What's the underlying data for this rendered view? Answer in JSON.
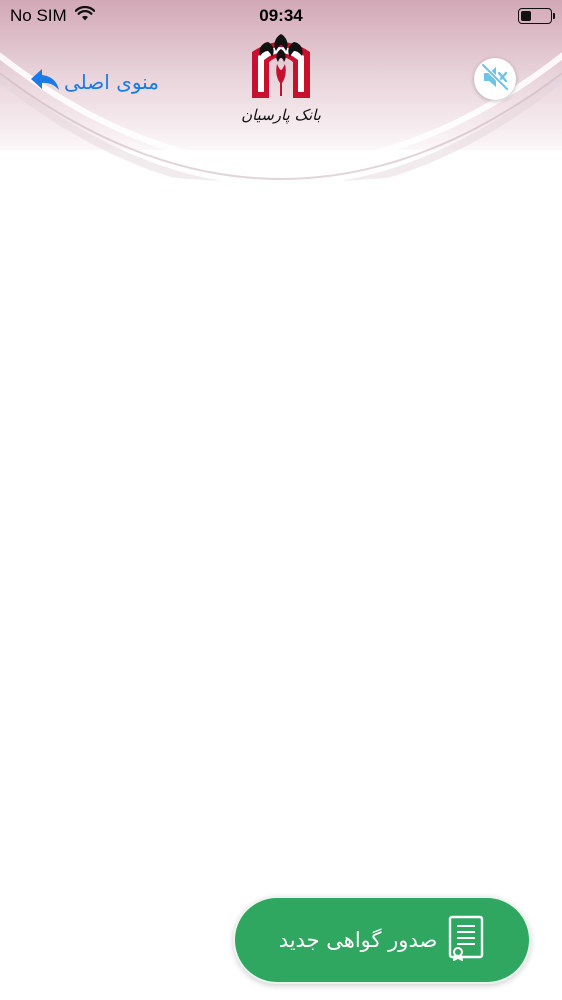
{
  "status_bar": {
    "carrier": "No SIM",
    "time": "09:34",
    "battery_level": 0.35
  },
  "header": {
    "back_label": "منوی اصلی",
    "back_icon": "reply-arrow-icon",
    "logo_text": "بانک پارسیان",
    "mute_icon": "speaker-muted-icon"
  },
  "actions": {
    "issue_certificate_label": "صدور گواهی جدید",
    "issue_certificate_icon": "certificate-document-icon"
  },
  "colors": {
    "accent_blue": "#1a7be8",
    "brand_red": "#c8102e",
    "primary_green": "#2fa761",
    "header_pink": "#d7b4c0",
    "mute_icon_color": "#6fc3e6"
  }
}
